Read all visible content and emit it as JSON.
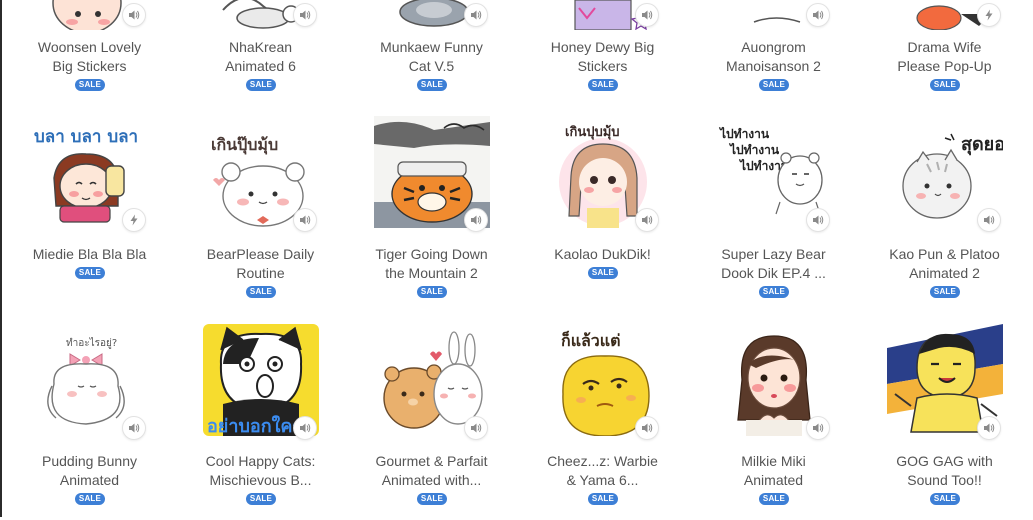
{
  "page": {
    "sale_badge": "SALE",
    "sound_icon": "speaker-icon",
    "animation_icon": "lightning-icon"
  },
  "rows": [
    [
      {
        "title": "Woonsen Lovely Big Stickers",
        "line1": "Woonsen Lovely",
        "line2": "Big Stickers",
        "icon": "speaker-icon"
      },
      {
        "title": "NhaKrean Animated 6",
        "line1": "NhaKrean",
        "line2": "Animated 6",
        "icon": "speaker-icon"
      },
      {
        "title": "Munkaew Funny Cat V.5",
        "line1": "Munkaew Funny",
        "line2": "Cat V.5",
        "icon": "speaker-icon"
      },
      {
        "title": "Honey Dewy Big Stickers",
        "line1": "Honey Dewy Big",
        "line2": "Stickers",
        "icon": "speaker-icon"
      },
      {
        "title": "Auongrom Manoisanson 2",
        "line1": "Auongrom",
        "line2": "Manoisanson 2",
        "icon": "speaker-icon"
      },
      {
        "title": "Drama Wife Please Pop-Up",
        "line1": "Drama Wife",
        "line2": "Please Pop-Up",
        "icon": "lightning-icon"
      }
    ],
    [
      {
        "title": "Miedie Bla Bla Bla",
        "line1": "Miedie Bla Bla Bla",
        "line2": "",
        "icon": "lightning-icon",
        "thai": "บลา บลา บลา"
      },
      {
        "title": "BearPlease Daily Routine",
        "line1": "BearPlease Daily",
        "line2": "Routine",
        "icon": "speaker-icon",
        "thai": "เกินปุ๊บมุ้บ"
      },
      {
        "title": "Tiger Going Down the Mountain 2",
        "line1": "Tiger Going Down",
        "line2": "the Mountain 2",
        "icon": "speaker-icon"
      },
      {
        "title": "Kaolao DukDik!",
        "line1": "Kaolao DukDik!",
        "line2": "",
        "icon": "speaker-icon",
        "thai": "เกินปุบมุ้บ"
      },
      {
        "title": "Super Lazy Bear Dook Dik EP.4 ...",
        "line1": "Super Lazy Bear",
        "line2": "Dook Dik EP.4 ...",
        "icon": "speaker-icon",
        "thai": "ไปทำงาน"
      },
      {
        "title": "Kao Pun & Platoo Animated 2",
        "line1": "Kao Pun & Platoo",
        "line2": "Animated 2",
        "icon": "speaker-icon",
        "thai": "สุดยอด!"
      }
    ],
    [
      {
        "title": "Pudding Bunny Animated",
        "line1": "Pudding Bunny",
        "line2": "Animated",
        "icon": "speaker-icon",
        "thai": "ทำอะไรอยู่?"
      },
      {
        "title": "Cool Happy Cats: Mischievous B...",
        "line1": "Cool Happy Cats:",
        "line2": "Mischievous B...",
        "icon": "speaker-icon",
        "thai": "อย่าบอกใคร"
      },
      {
        "title": "Gourmet & Parfait Animated with...",
        "line1": "Gourmet & Parfait",
        "line2": "Animated with...",
        "icon": "speaker-icon"
      },
      {
        "title": "Cheez...z: Warbie & Yama 6...",
        "line1": "Cheez...z: Warbie",
        "line2": "& Yama 6...",
        "icon": "speaker-icon",
        "thai": "ก็แล้วแต่"
      },
      {
        "title": "Milkie Miki Animated",
        "line1": "Milkie Miki",
        "line2": "Animated",
        "icon": "speaker-icon"
      },
      {
        "title": "GOG GAG with Sound Too!!",
        "line1": "GOG GAG with",
        "line2": "Sound Too!!",
        "icon": "speaker-icon"
      }
    ]
  ]
}
